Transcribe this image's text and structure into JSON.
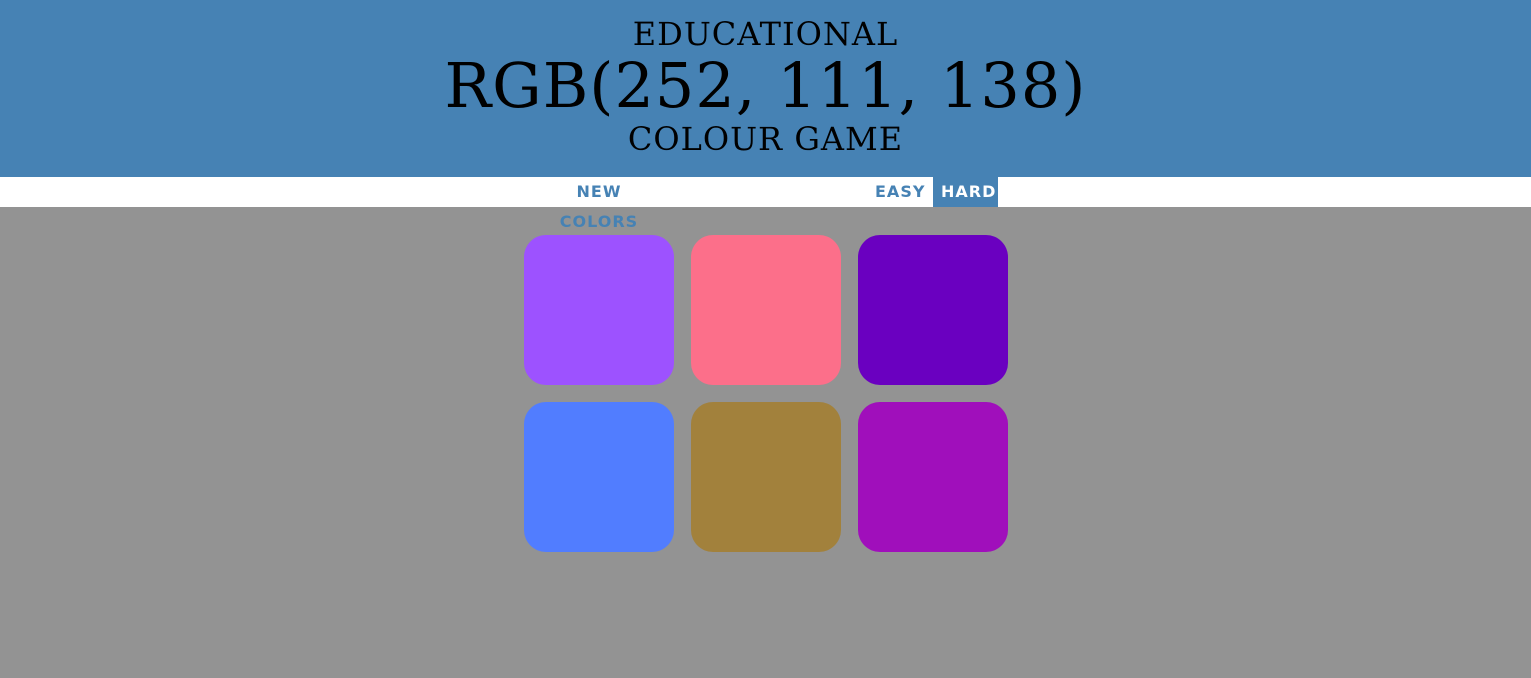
{
  "header": {
    "line1": "EDUCATIONAL",
    "target_rgb": "RGB(252, 111, 138)",
    "line3": "COLOUR GAME",
    "background_color": "#4682b4"
  },
  "controls": {
    "new_colors_label": "NEW COLORS",
    "easy_label": "EASY",
    "hard_label": "HARD",
    "selected_mode": "HARD"
  },
  "game": {
    "background_color": "#939393",
    "squares": [
      {
        "color": "#9d52ff"
      },
      {
        "color": "#fc6f8a"
      },
      {
        "color": "#6a00c0"
      },
      {
        "color": "#517dff"
      },
      {
        "color": "#a2813c"
      },
      {
        "color": "#a00fbb"
      }
    ]
  }
}
